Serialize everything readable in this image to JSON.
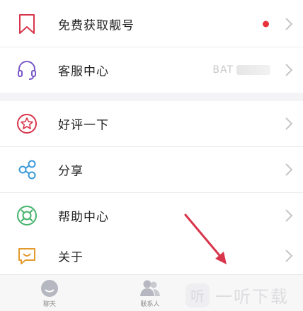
{
  "menu": {
    "items": [
      {
        "label": "免费获取靓号",
        "icon": "bookmark-icon",
        "has_dot": true
      },
      {
        "label": "客服中心",
        "icon": "headset-icon",
        "value": "BAT"
      },
      {
        "label": "好评一下",
        "icon": "star-badge-icon"
      },
      {
        "label": "分享",
        "icon": "share-icon"
      },
      {
        "label": "帮助中心",
        "icon": "help-ring-icon"
      },
      {
        "label": "关于",
        "icon": "chat-smile-icon"
      }
    ]
  },
  "tabbar": {
    "tabs": [
      {
        "label": "聊天",
        "icon": "chat-face-icon"
      },
      {
        "label": "联系人",
        "icon": "contacts-icon"
      }
    ]
  },
  "watermark": {
    "text": "一听下载",
    "logo_char": "听"
  },
  "colors": {
    "accent_red": "#e8323a",
    "text": "#222222",
    "icon_red": "#d9364c",
    "icon_blue": "#3a9ad9",
    "icon_green": "#45b36b"
  }
}
